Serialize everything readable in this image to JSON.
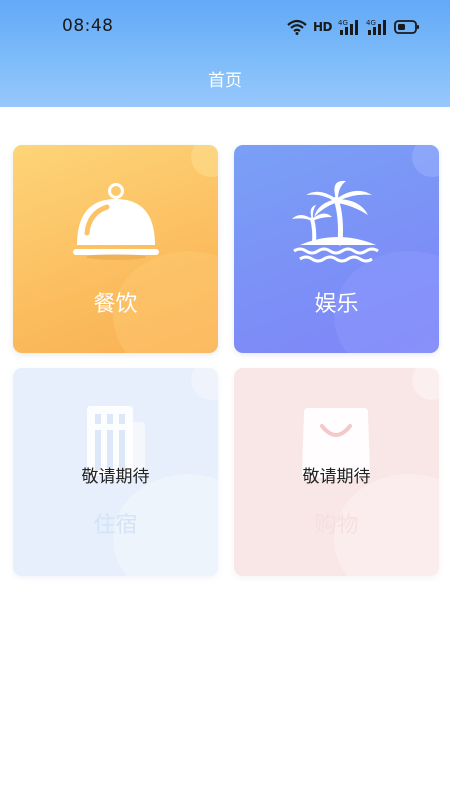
{
  "status_bar": {
    "time": "08:48",
    "network_label": "HD",
    "signal_1_label": "4G",
    "signal_2_label": "4G"
  },
  "header": {
    "title": "首页"
  },
  "colors": {
    "header_gradient_top": "#62a9f7",
    "header_gradient_bottom": "#97c8fb",
    "dining": "#fbbd5f",
    "entertainment": "#7c8ff7",
    "lodging": "#e6effb",
    "shopping": "#f9e6e6"
  },
  "cards": [
    {
      "id": "dining",
      "label": "餐饮",
      "icon": "cloche-icon",
      "status": ""
    },
    {
      "id": "entertainment",
      "label": "娱乐",
      "icon": "palm-island-icon",
      "status": ""
    },
    {
      "id": "lodging",
      "label": "住宿",
      "icon": "building-icon",
      "status": "敬请期待"
    },
    {
      "id": "shopping",
      "label": "购物",
      "icon": "shopping-bag-icon",
      "status": "敬请期待"
    }
  ]
}
